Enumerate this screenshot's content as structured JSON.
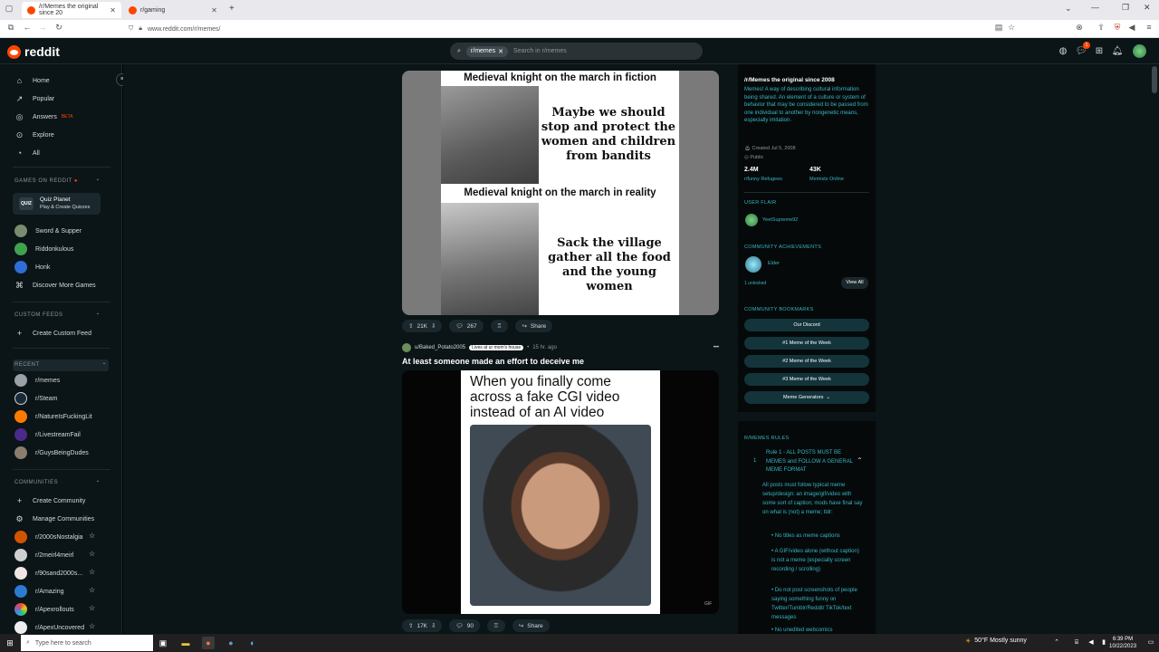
{
  "browser": {
    "tabs": [
      {
        "title": "/r/Memes the original since 20",
        "active": true
      },
      {
        "title": "r/gaming",
        "active": false
      }
    ],
    "new_tab": "+",
    "url": "www.reddit.com/r/memes/"
  },
  "header": {
    "logo_text": "reddit",
    "search_chip": "r/memes",
    "search_placeholder": "Search in r/memes",
    "icons": [
      "advertise-icon",
      "chat-icon",
      "create-icon",
      "notification-icon",
      "avatar"
    ],
    "chat_badge": "1"
  },
  "sidebar": {
    "nav": [
      {
        "label": "Home",
        "icon": "home-icon"
      },
      {
        "label": "Popular",
        "icon": "popular-icon"
      },
      {
        "label": "Answers",
        "icon": "answers-icon",
        "badge": "BETA"
      },
      {
        "label": "Explore",
        "icon": "explore-icon"
      },
      {
        "label": "All",
        "icon": "all-icon"
      }
    ],
    "games_header": "GAMES ON REDDIT",
    "quiz": {
      "title": "Quiz Planet",
      "subtitle": "Play & Create Quizzes",
      "icon_text": "QUIZ"
    },
    "games": [
      "Sword & Supper",
      "Riddonkulous",
      "Honk",
      "Discover More Games"
    ],
    "custom_feeds_header": "CUSTOM FEEDS",
    "create_custom_feed": "Create Custom Feed",
    "recent_header": "RECENT",
    "recent": [
      "r/memes",
      "r/Steam",
      "r/NatureIsFuckingLit",
      "r/LivestreamFail",
      "r/GuysBeingDudes"
    ],
    "communities_header": "COMMUNITIES",
    "create_community": "Create Community",
    "manage_communities": "Manage Communities",
    "communities": [
      "r/2000sNostalgia",
      "r/2meirl4meirl",
      "r/90sand2000s...",
      "r/Amazing",
      "r/Apexrollouts",
      "r/ApexUncovered"
    ]
  },
  "posts": [
    {
      "meme": {
        "top_caption": "Medieval knight on the march in fiction",
        "top_text": "Maybe we should stop and protect the women and children from bandits",
        "bottom_caption": "Medieval knight on the march in reality",
        "bottom_text": "Sack the village gather all the food and the young women"
      },
      "votes": "21K",
      "comments": "267",
      "share": "Share"
    },
    {
      "author": "u/Baked_Potato2005",
      "flair": "Lives at ur mom's house",
      "time": "15 hr. ago",
      "more": "•••",
      "title": "At least someone made an effort to deceive me",
      "meme_text": "When you finally come across a fake CGI video instead of an AI video",
      "gif_label": "GIF",
      "votes": "17K",
      "comments": "90",
      "share": "Share"
    }
  ],
  "rail": {
    "title": "/r/Memes the original since 2008",
    "description": "Memes! A way of describing cultural information being shared. An element of a culture or system of behavior that may be considered to be passed from one individual to another by nongenetic means, especially imitation.",
    "created": "Created Jul 5, 2008",
    "visibility": "Public",
    "stats": [
      {
        "value": "2.4M",
        "label": "r/funny Refugees"
      },
      {
        "value": "43K",
        "label": "Memists Online"
      }
    ],
    "user_flair_header": "USER FLAIR",
    "user_flair": "YeetSupreme92",
    "achievements_header": "COMMUNITY ACHIEVEMENTS",
    "achievement": "Elder",
    "unlocked": "1 unlocked",
    "view_all": "View All",
    "bookmarks_header": "COMMUNITY BOOKMARKS",
    "bookmarks": [
      "Our Discord",
      "#1 Meme of the Week",
      "#2 Meme of the Week",
      "#3 Meme of the Week",
      "Meme Generators"
    ],
    "rules_header": "R/MEMES RULES",
    "rule1_number": "1",
    "rule1_title": "Rule 1 - ALL POSTS MUST BE MEMES and FOLLOW A GENERAL MEME FORMAT",
    "rule1_body": "All posts must follow typical meme setup/design: an image/gif/video with some sort of caption; mods have final say on what is (not) a meme; tldr:",
    "rule1_bullets": [
      "No titles as meme captions",
      "A GIF/video alone (without caption) is not a meme (especially screen recording / scrolling)",
      "Do not post screenshots of people saying something funny on Twitter/Tumblr/Reddit/ TikTok/text messages",
      "No unedited webcomics"
    ]
  },
  "taskbar": {
    "search_placeholder": "Type here to search",
    "weather": "50°F  Mostly sunny",
    "time": "6:39 PM",
    "date": "10/22/2023"
  },
  "colors": {
    "accent": "#ff4500",
    "bg": "#0b1416",
    "link": "#36b6c2"
  }
}
